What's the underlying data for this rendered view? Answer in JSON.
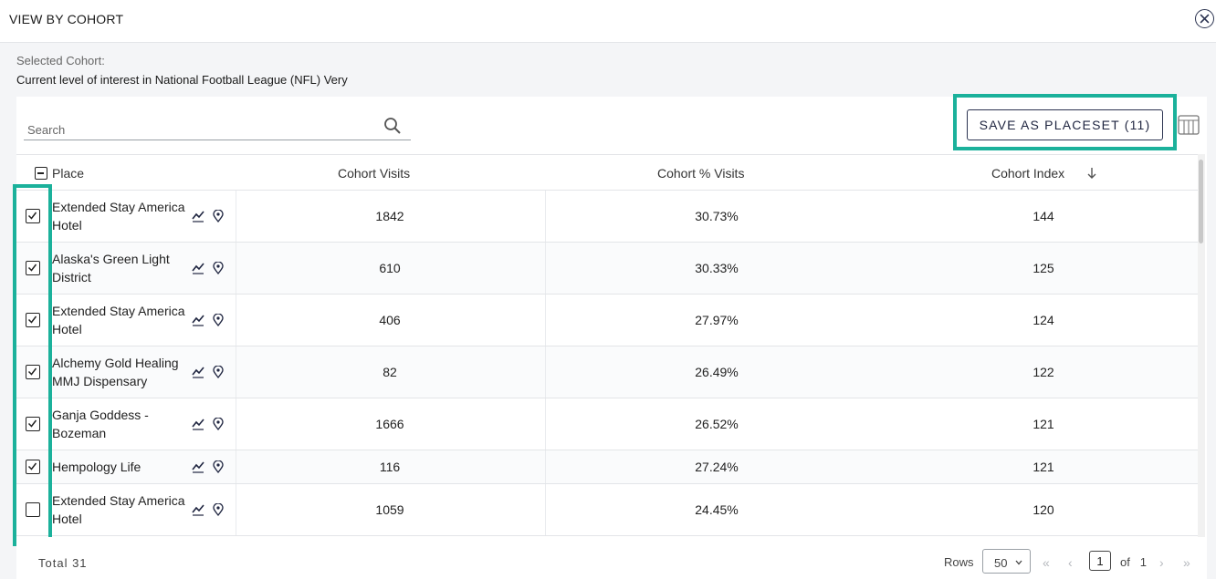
{
  "modal": {
    "title": "VIEW BY COHORT",
    "selected_cohort_label": "Selected Cohort:",
    "selected_cohort_value": "Current level of interest in National Football League (NFL) Very"
  },
  "toolbar": {
    "search_placeholder": "Search",
    "save_label": "SAVE AS PLACESET (11)"
  },
  "table": {
    "columns": [
      "Place",
      "Cohort Visits",
      "Cohort % Visits",
      "Cohort Index"
    ],
    "rows": [
      {
        "place": "Extended Stay America Hotel",
        "checked": true,
        "visits": "1842",
        "pct": "30.73%",
        "index": "144"
      },
      {
        "place": "Alaska's Green Light District",
        "checked": true,
        "visits": "610",
        "pct": "30.33%",
        "index": "125"
      },
      {
        "place": "Extended Stay America Hotel",
        "checked": true,
        "visits": "406",
        "pct": "27.97%",
        "index": "124"
      },
      {
        "place": "Alchemy Gold Healing MMJ Dispensary",
        "checked": true,
        "visits": "82",
        "pct": "26.49%",
        "index": "122"
      },
      {
        "place": "Ganja Goddess - Bozeman",
        "checked": true,
        "visits": "1666",
        "pct": "26.52%",
        "index": "121"
      },
      {
        "place": "Hempology Life",
        "checked": true,
        "visits": "116",
        "pct": "27.24%",
        "index": "121"
      },
      {
        "place": "Extended Stay America Hotel",
        "checked": false,
        "visits": "1059",
        "pct": "24.45%",
        "index": "120"
      }
    ]
  },
  "footer": {
    "total": "Total 31",
    "rows_label": "Rows",
    "rows_per_page": "50",
    "current_page": "1",
    "of_label": "of",
    "total_pages": "1"
  },
  "colors": {
    "highlight": "#1bb19b",
    "button_border": "#2b3350"
  },
  "icons": [
    "close-icon",
    "search-icon",
    "grid-icon",
    "trend-icon",
    "map-pin-icon",
    "sort-down-icon",
    "chevron-down-icon"
  ]
}
